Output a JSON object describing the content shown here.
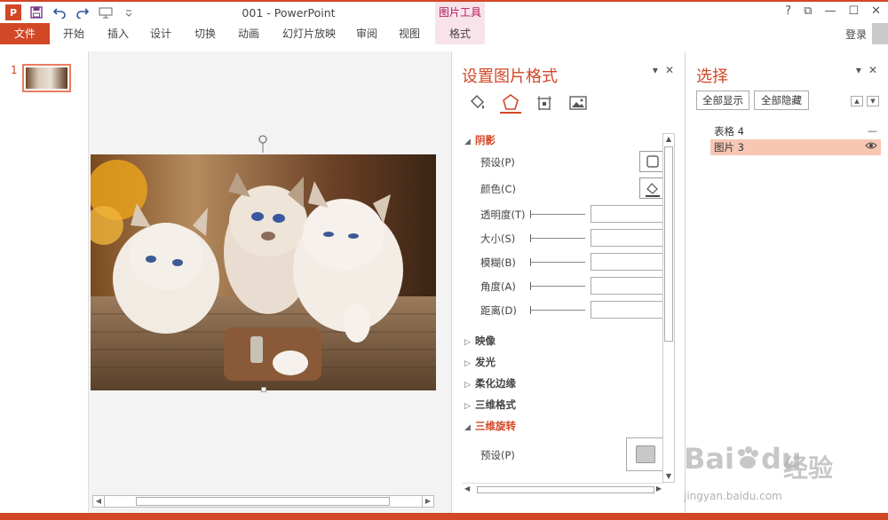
{
  "window": {
    "title": "001 - PowerPoint",
    "context_group": "图片工具",
    "controls": [
      "?",
      "⧉",
      "—",
      "☐",
      "✕"
    ],
    "user": "登录"
  },
  "ribbon": {
    "tabs": [
      "文件",
      "开始",
      "插入",
      "设计",
      "切换",
      "动画",
      "幻灯片放映",
      "审阅",
      "视图"
    ],
    "context_tab": "格式"
  },
  "thumbnails": {
    "slide_number": "1"
  },
  "format_pane": {
    "title": "设置图片格式",
    "sections": {
      "shadow": "阴影",
      "reflection": "映像",
      "glow": "发光",
      "soft_edges": "柔化边缘",
      "bevel": "三维格式",
      "rotation_3d": "三维旋转"
    },
    "shadow_rows": {
      "preset": "预设(P)",
      "color": "颜色(C)",
      "transparency": "透明度(T)",
      "size": "大小(S)",
      "blur": "模糊(B)",
      "angle": "角度(A)",
      "distance": "距离(D)"
    },
    "rotation_rows": {
      "preset": "预设(P)"
    }
  },
  "selection_pane": {
    "title": "选择",
    "show_all": "全部显示",
    "hide_all": "全部隐藏",
    "items": [
      {
        "name": "表格 4",
        "visibility": "—"
      },
      {
        "name": "图片 3",
        "visibility": "◉"
      }
    ]
  },
  "watermark": {
    "brand": "Bai",
    "brand2": "du",
    "cn": "经验",
    "url": "jingyan.baidu.com"
  },
  "colors": {
    "accent": "#d24726",
    "context_tab": "#f9e3ea",
    "selected_item": "#f7c7b4"
  }
}
